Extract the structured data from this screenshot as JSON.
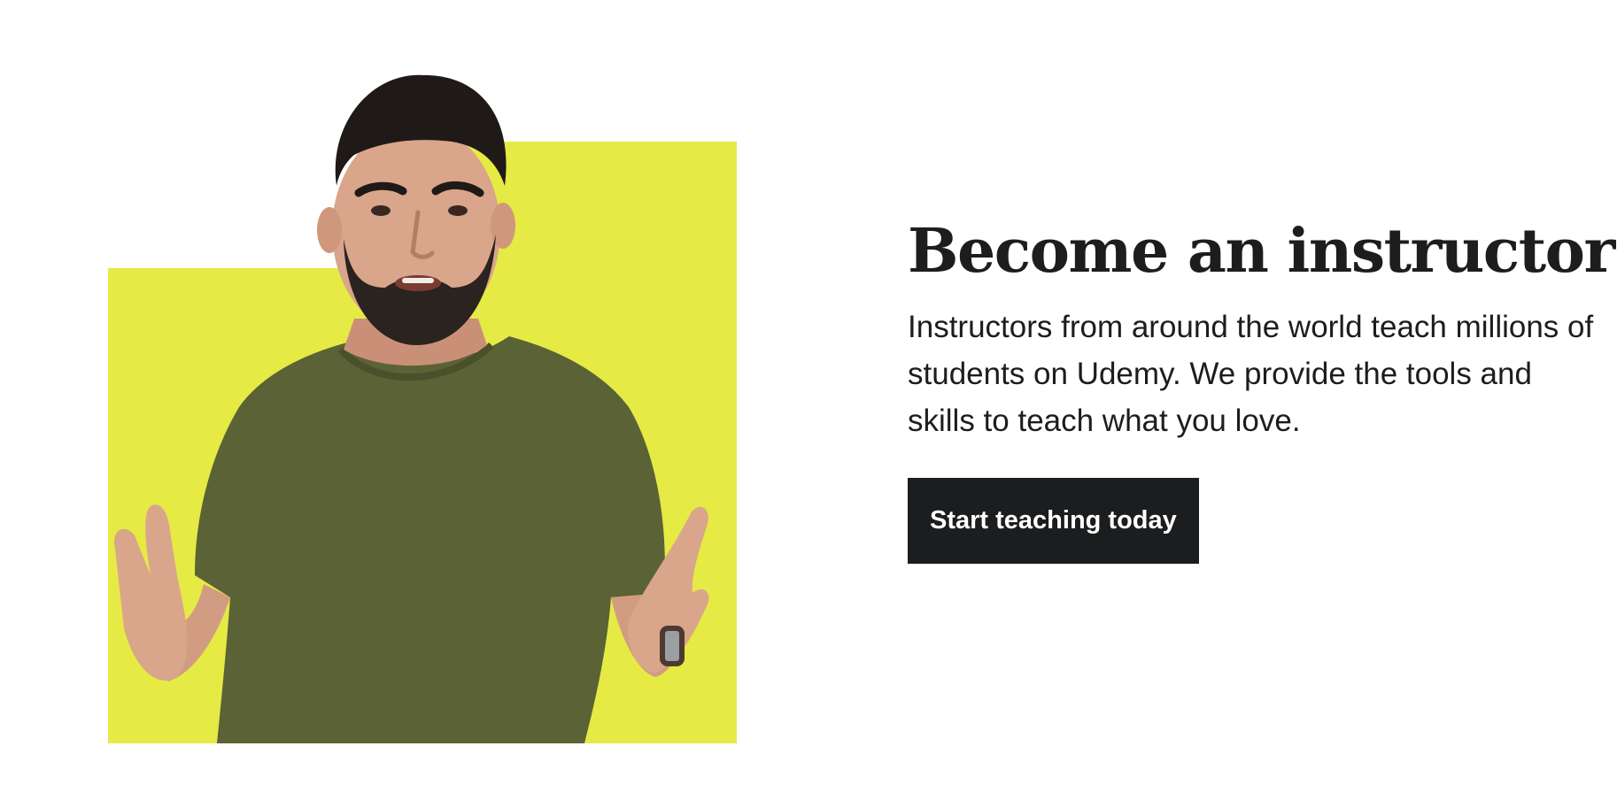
{
  "hero": {
    "heading": "Become an instructor",
    "description": "Instructors from around the world teach millions of students on Udemy. We provide the tools and skills to teach what you love.",
    "cta_label": "Start teaching today"
  },
  "colors": {
    "accent_block": "#e5ea45",
    "text": "#1c1d1f",
    "button_bg": "#1c1d1f",
    "button_text": "#ffffff",
    "shirt": "#5b6236",
    "skin": "#d9a58b",
    "hair": "#1f1a17"
  },
  "icons": {
    "illustration": "instructor-photo"
  }
}
